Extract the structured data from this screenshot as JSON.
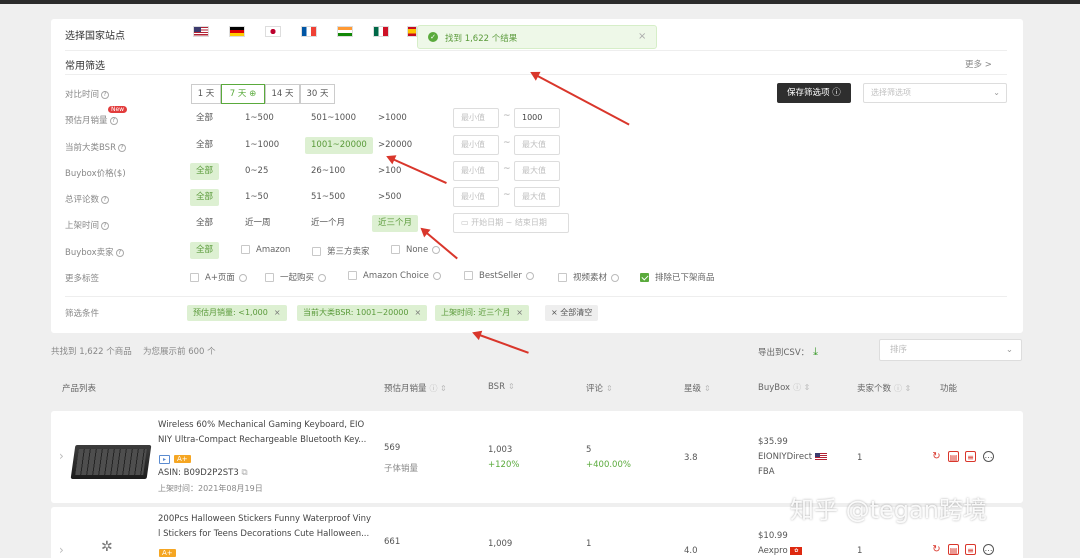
{
  "toast": {
    "text": "找到 1,622 个结果",
    "close": "×"
  },
  "country": {
    "label": "选择国家站点"
  },
  "common": {
    "label": "常用筛选",
    "more": "更多 >"
  },
  "rows": {
    "compare": {
      "label": "对比时间",
      "days": [
        "1 天",
        "7 天 ⊕",
        "14 天",
        "30 天"
      ],
      "save": "保存筛选项",
      "select_placeholder": "选择筛选项"
    },
    "sales": {
      "label": "预估月销量",
      "badge": "New",
      "opts": [
        "全部",
        "1~500",
        "501~1000",
        ">1000"
      ],
      "min": "最小值",
      "max": "1000"
    },
    "bsr": {
      "label": "当前大类BSR",
      "opts": [
        "全部",
        "1~1000",
        "1001~20000",
        ">20000"
      ],
      "min": "最小值",
      "max": "最大值"
    },
    "price": {
      "label": "Buybox价格($)",
      "opts": [
        "全部",
        "0~25",
        "26~100",
        ">100"
      ],
      "min": "最小值",
      "max": "最大值"
    },
    "reviews": {
      "label": "总评论数",
      "opts": [
        "全部",
        "1~50",
        "51~500",
        ">500"
      ],
      "min": "最小值",
      "max": "最大值"
    },
    "listed": {
      "label": "上架时间",
      "opts": [
        "全部",
        "近一周",
        "近一个月",
        "近三个月"
      ],
      "start": "开始日期",
      "end": "结束日期"
    },
    "seller": {
      "label": "Buybox卖家",
      "opts": [
        "全部",
        "Amazon",
        "第三方卖家",
        "None"
      ]
    },
    "tags": {
      "label": "更多标签",
      "items": [
        "A+页面",
        "一起购买",
        "Amazon Choice",
        "BestSeller",
        "视频素材",
        "排除已下架商品"
      ]
    },
    "conds": {
      "label": "筛选条件",
      "items": [
        "预估月销量: <1,000",
        "当前大类BSR: 1001~20000",
        "上架时间: 近三个月"
      ],
      "clear": "全部清空"
    }
  },
  "summary": {
    "found": "共找到 1,622 个商品",
    "showing": "为您展示前 600 个",
    "export": "导出到CSV：",
    "sort_placeholder": "排序"
  },
  "table": {
    "headers": [
      "产品列表",
      "预估月销量",
      "BSR",
      "评论",
      "星级",
      "BuyBox",
      "卖家个数",
      "功能"
    ]
  },
  "products": [
    {
      "title1": "Wireless 60% Mechanical Gaming Keyboard, EIO",
      "title2": "NIY Ultra-Compact Rechargeable Bluetooth Key...",
      "badge": "A+",
      "asin": "ASIN: B09D2P2ST3",
      "listed": "上架时间：2021年08月19日",
      "sales": "569",
      "sales_sub": "子体销量",
      "bsr": "1,003",
      "bsr_change": "+120%",
      "reviews": "5",
      "reviews_change": "+400.00%",
      "rating": "3.8",
      "price": "$35.99",
      "seller": "EIONIYDirect",
      "fulfil": "FBA",
      "sellers": "1"
    },
    {
      "title1": "200Pcs Halloween Stickers Funny Waterproof Viny",
      "title2": "l Stickers for Teens Decorations Cute Halloween...",
      "badge": "A+",
      "sales": "661",
      "bsr": "1,009",
      "reviews": "1",
      "rating": "4.0",
      "price": "$10.99",
      "seller": "Aexpro",
      "sellers": "1"
    }
  ],
  "watermark": "知乎 @tegan跨境",
  "colors": {
    "accent": "#5aaa3c",
    "arrow": "#d9362b",
    "button": "#2e2e2e"
  }
}
